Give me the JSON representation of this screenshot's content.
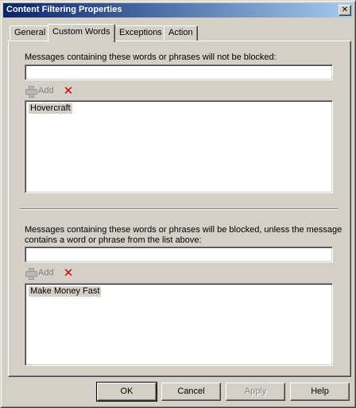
{
  "window": {
    "title": "Content Filtering Properties",
    "close_glyph": "✕"
  },
  "tabs": [
    {
      "label": "General",
      "active": false
    },
    {
      "label": "Custom Words",
      "active": true
    },
    {
      "label": "Exceptions",
      "active": false
    },
    {
      "label": "Action",
      "active": false
    }
  ],
  "allow_section": {
    "label": "Messages containing these words or phrases will not be blocked:",
    "input_value": "",
    "add_label": "Add",
    "delete_icon": "red-x-icon",
    "items": [
      "Hovercraft"
    ]
  },
  "block_section": {
    "label_line1": "Messages containing these words or phrases will be blocked, unless the message",
    "label_line2": "contains a word or phrase from the list above:",
    "input_value": "",
    "add_label": "Add",
    "delete_icon": "red-x-icon",
    "items": [
      "Make Money Fast"
    ]
  },
  "buttons": {
    "ok": "OK",
    "cancel": "Cancel",
    "apply": "Apply",
    "help": "Help"
  }
}
